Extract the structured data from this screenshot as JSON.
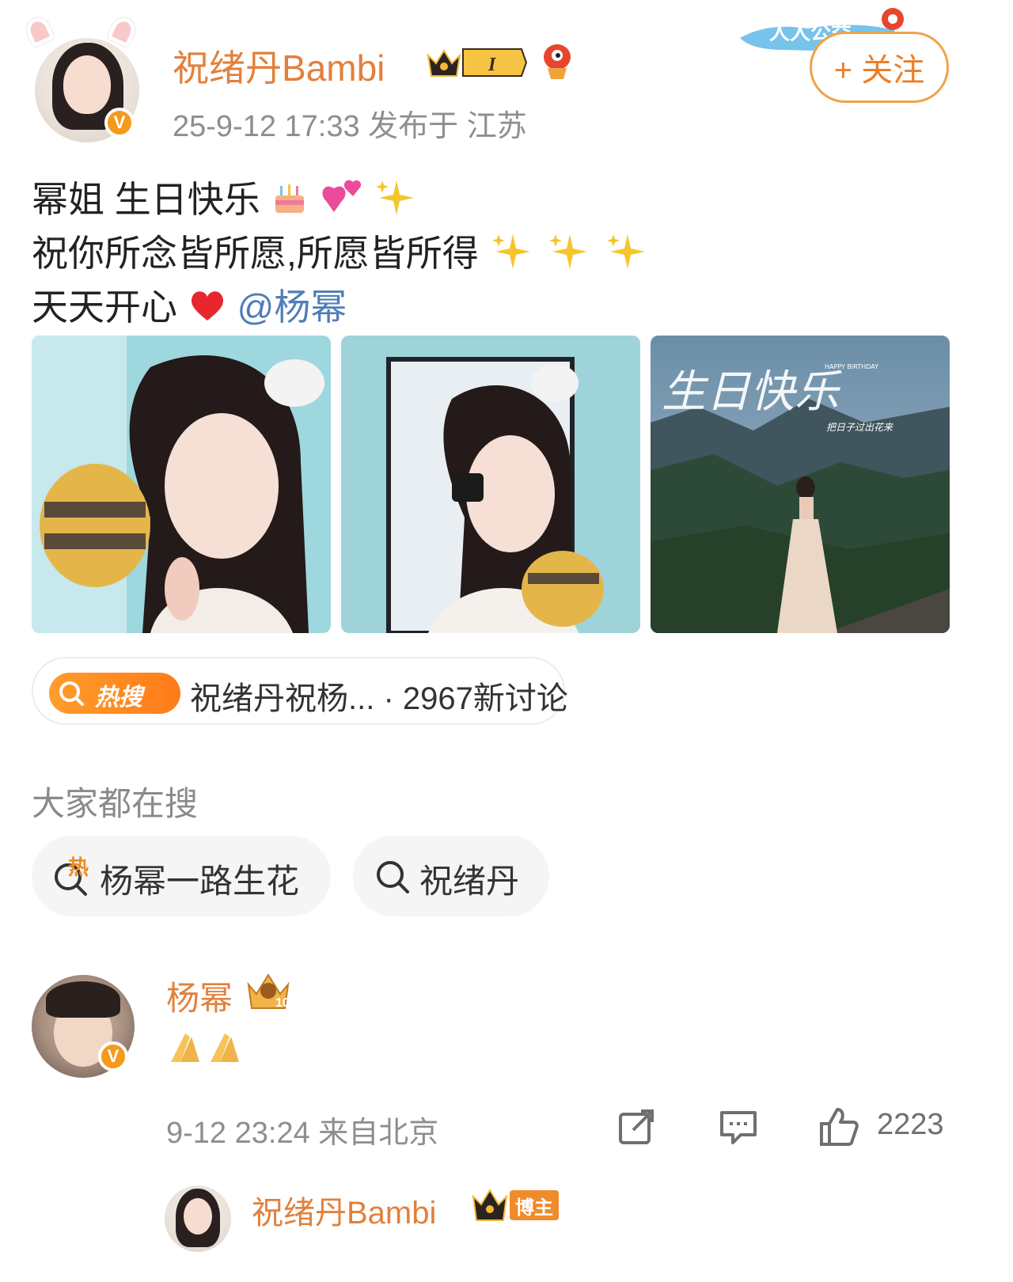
{
  "post": {
    "author": "祝绪丹Bambi",
    "level_badge": "I",
    "meta": "25-9-12 17:33  发布于 江苏",
    "follow_label": "+ 关注",
    "banner_text": "人人公益",
    "line1": "幂姐 生日快乐",
    "line2": "祝你所念皆所愿,所愿皆所得",
    "line3": "天天开心",
    "mention": "@杨幂",
    "images": [
      {
        "name": "photo-1"
      },
      {
        "name": "photo-2"
      },
      {
        "name": "photo-3",
        "overlay_text": "生日快乐",
        "small_en": "HAPPY BIRTHDAY",
        "small_cn": "把日子过出花来"
      }
    ]
  },
  "hot_search": {
    "badge": "热搜",
    "text": "祝绪丹祝杨... · 2967新讨论"
  },
  "trending": {
    "title": "大家都在搜",
    "items": [
      {
        "label": "杨幂一路生花",
        "badge": "热"
      },
      {
        "label": "祝绪丹"
      }
    ]
  },
  "reply": {
    "author": "杨幂",
    "level": "10",
    "meta": "9-12 23:24 来自北京",
    "likes": "2223"
  },
  "sub_reply": {
    "author": "祝绪丹Bambi",
    "badge": "博主"
  },
  "colors": {
    "username": "#e2803c",
    "mention": "#4f7eb8",
    "accent": "#f59a1b"
  }
}
